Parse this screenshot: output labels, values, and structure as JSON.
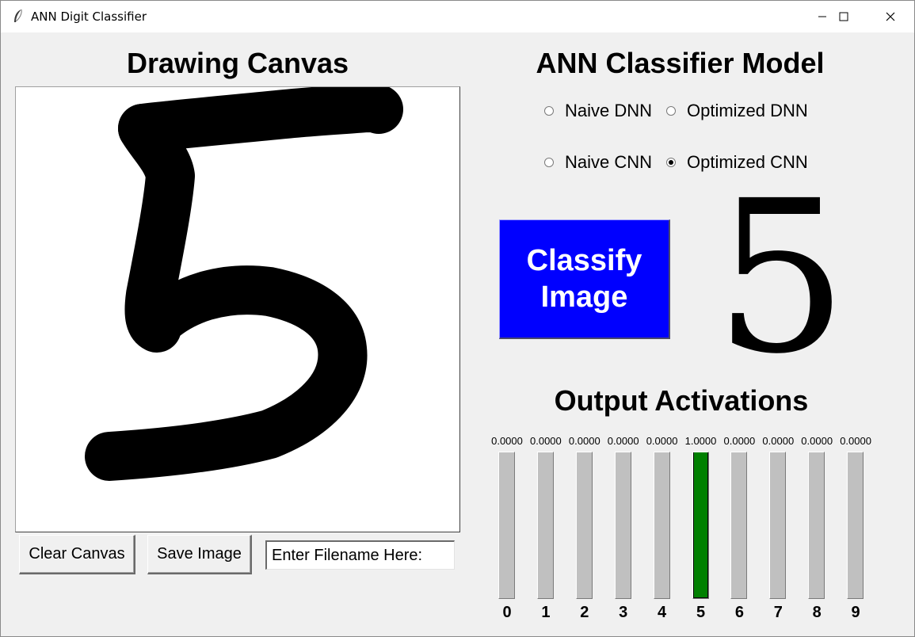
{
  "window": {
    "title": "ANN Digit Classifier",
    "controls": [
      "minimize-icon",
      "maximize-icon",
      "close-icon"
    ]
  },
  "canvas_section": {
    "heading": "Drawing Canvas",
    "drawn_digit": "5",
    "clear_label": "Clear Canvas",
    "save_label": "Save Image",
    "filename_value": "Enter Filename Here:"
  },
  "model_section": {
    "heading": "ANN Classifier Model",
    "options": [
      {
        "label": "Naive DNN",
        "checked": false
      },
      {
        "label": "Optimized DNN",
        "checked": false
      },
      {
        "label": "Naive CNN",
        "checked": false
      },
      {
        "label": "Optimized CNN",
        "checked": true
      }
    ],
    "classify_line1": "Classify",
    "classify_line2": "Image",
    "classify_color": "#0000ff",
    "prediction": "5"
  },
  "activations": {
    "heading": "Output Activations",
    "fill_color": "#008000",
    "items": [
      {
        "digit": "0",
        "value": "0.0000",
        "level": 0
      },
      {
        "digit": "1",
        "value": "0.0000",
        "level": 0
      },
      {
        "digit": "2",
        "value": "0.0000",
        "level": 0
      },
      {
        "digit": "3",
        "value": "0.0000",
        "level": 0
      },
      {
        "digit": "4",
        "value": "0.0000",
        "level": 0
      },
      {
        "digit": "5",
        "value": "1.0000",
        "level": 1
      },
      {
        "digit": "6",
        "value": "0.0000",
        "level": 0
      },
      {
        "digit": "7",
        "value": "0.0000",
        "level": 0
      },
      {
        "digit": "8",
        "value": "0.0000",
        "level": 0
      },
      {
        "digit": "9",
        "value": "0.0000",
        "level": 0
      }
    ]
  }
}
